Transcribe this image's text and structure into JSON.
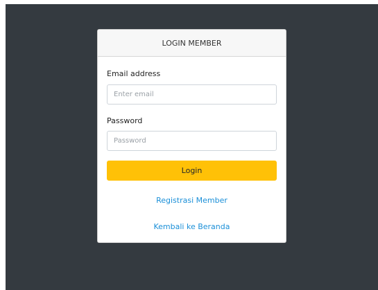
{
  "header": {
    "title": "LOGIN MEMBER"
  },
  "form": {
    "email_label": "Email address",
    "email_placeholder": "Enter email",
    "email_value": "",
    "password_label": "Password",
    "password_placeholder": "Password",
    "password_value": "",
    "login_label": "Login"
  },
  "links": {
    "register": "Registrasi Member",
    "home": "Kembali ke Beranda"
  },
  "colors": {
    "backdrop": "#343a40",
    "button": "#ffc107",
    "link": "#1a8fd8"
  }
}
